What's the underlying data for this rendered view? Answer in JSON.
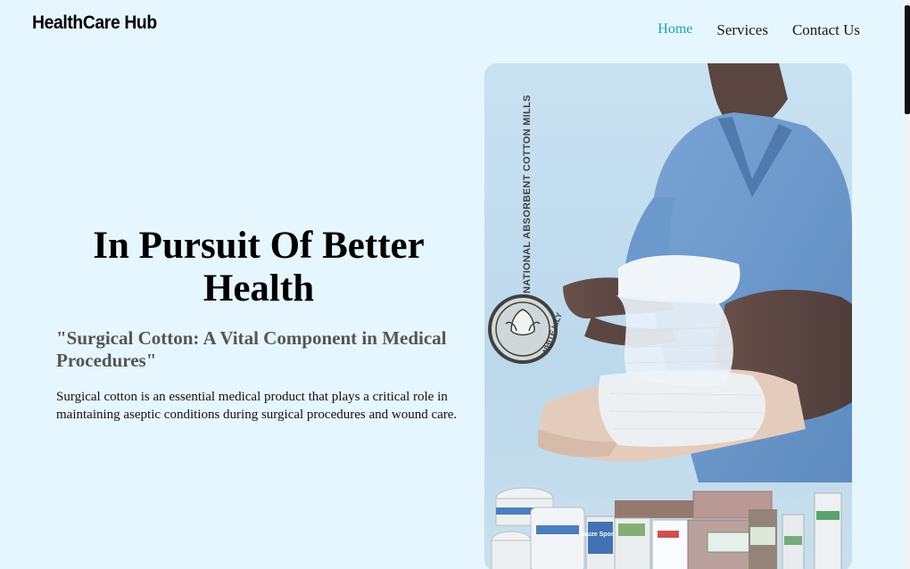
{
  "header": {
    "brand": "HealthCare Hub",
    "nav": [
      {
        "label": "Home",
        "active": true
      },
      {
        "label": "Services",
        "active": false
      },
      {
        "label": "Contact Us",
        "active": false
      }
    ]
  },
  "hero": {
    "title": "In Pursuit Of Better Health",
    "subtitle": "\"Surgical Cotton: A Vital Component in Medical Procedures\"",
    "body": "Surgical cotton is an essential medical product that plays a critical role in maintaining aseptic conditions during surgical procedures and wound care.",
    "image": {
      "vertical_text": "NATIONAL ABSORBENT COTTON MILLS",
      "logo_text": "WHITE LILY",
      "product_text": "Gauze Sponge"
    }
  },
  "colors": {
    "background": "#e6f6fe",
    "nav_active": "#1aa3b3",
    "scrub": "#5f8fc6"
  }
}
